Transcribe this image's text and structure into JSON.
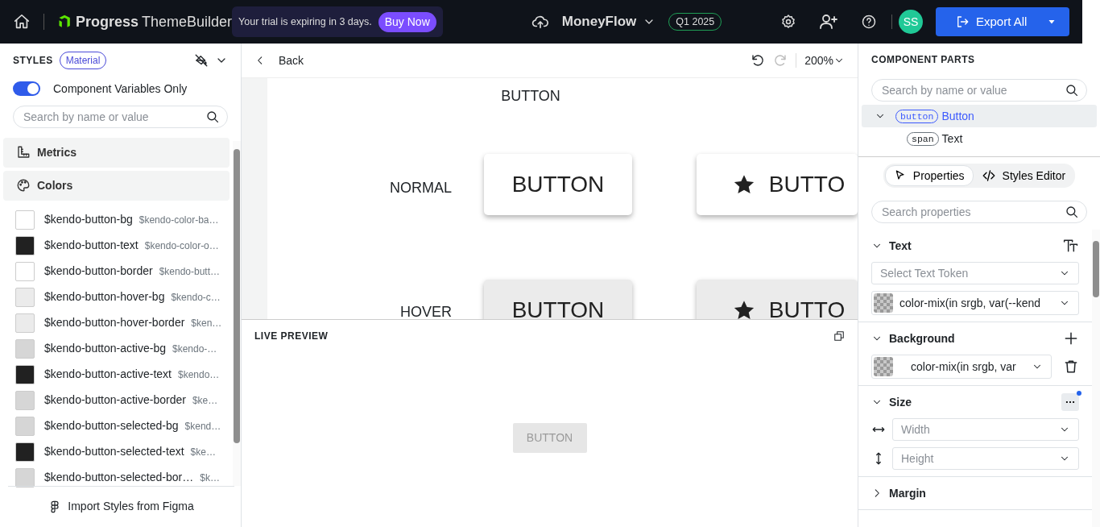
{
  "header": {
    "brand": "Progress",
    "product": "ThemeBuilder",
    "trial": {
      "message": "Your trial is expiring in 3 days.",
      "button": "Buy Now"
    },
    "project": {
      "name": "MoneyFlow",
      "badge": "Q1 2025"
    },
    "avatar": "SS",
    "export": "Export All"
  },
  "styles": {
    "title": "STYLES",
    "theme": "Material",
    "toggle": {
      "label": "Component Variables Only",
      "on": true
    },
    "search": {
      "placeholder": "Search by name or value"
    },
    "groups": [
      {
        "kind": "metrics",
        "label": "Metrics"
      },
      {
        "kind": "colors",
        "label": "Colors"
      }
    ],
    "variables": [
      {
        "name": "$kendo-button-bg",
        "value": "$kendo-color-ba…",
        "color": "#ffffff"
      },
      {
        "name": "$kendo-button-text",
        "value": "$kendo-color-o…",
        "color": "#212121"
      },
      {
        "name": "$kendo-button-border",
        "value": "$kendo-butt…",
        "color": "#ffffff"
      },
      {
        "name": "$kendo-button-hover-bg",
        "value": "$kendo-c…",
        "color": "#ebebeb"
      },
      {
        "name": "$kendo-button-hover-border",
        "value": "$ken…",
        "color": "#ebebeb"
      },
      {
        "name": "$kendo-button-active-bg",
        "value": "$kendo-…",
        "color": "#d6d6d6"
      },
      {
        "name": "$kendo-button-active-text",
        "value": "$kendo…",
        "color": "#212121"
      },
      {
        "name": "$kendo-button-active-border",
        "value": "$ke…",
        "color": "#d6d6d6"
      },
      {
        "name": "$kendo-button-selected-bg",
        "value": "$kend…",
        "color": "#d6d6d6"
      },
      {
        "name": "$kendo-button-selected-text",
        "value": "$ke…",
        "color": "#212121"
      },
      {
        "name": "$kendo-button-selected-bor…",
        "value": "$k…",
        "color": "#d6d6d6"
      }
    ],
    "import": "Import Styles from Figma"
  },
  "canvas": {
    "back": "Back",
    "zoom": "200%",
    "title": "BUTTON",
    "states": [
      {
        "label": "NORMAL",
        "kind": "normal",
        "buttons": [
          {
            "text": "BUTTON",
            "icon": false
          },
          {
            "text": "BUTTO",
            "icon": true
          }
        ]
      },
      {
        "label": "HOVER",
        "kind": "hover",
        "buttons": [
          {
            "text": "BUTTON",
            "icon": false
          },
          {
            "text": "BUTTO",
            "icon": true
          }
        ]
      }
    ],
    "preview": {
      "title": "LIVE PREVIEW",
      "button": "BUTTON"
    }
  },
  "parts": {
    "title": "COMPONENT PARTS",
    "search": {
      "placeholder": "Search by name or value"
    },
    "tree": [
      {
        "tag": "button",
        "label": "Button",
        "expanded": true,
        "selected": true,
        "children": [
          {
            "tag": "span",
            "label": "Text",
            "selected": false
          }
        ]
      }
    ],
    "tabs": [
      {
        "label": "Properties",
        "selected": true
      },
      {
        "label": "Styles Editor",
        "selected": false
      }
    ],
    "property_search": {
      "placeholder": "Search properties"
    },
    "sections": [
      {
        "title": "Text",
        "kind": "text",
        "expanded": true,
        "fields": [
          {
            "kind": "select",
            "placeholder": "Select Text Token"
          },
          {
            "kind": "color",
            "value": "color-mix(in srgb, var(--kend"
          }
        ]
      },
      {
        "title": "Background",
        "kind": "background",
        "expanded": true,
        "fields": [
          {
            "kind": "color-removable",
            "value": "color-mix(in srgb, var"
          }
        ]
      },
      {
        "title": "Size",
        "kind": "size",
        "expanded": true,
        "fields": [
          {
            "kind": "width",
            "placeholder": "Width"
          },
          {
            "kind": "height",
            "placeholder": "Height"
          }
        ]
      },
      {
        "title": "Margin",
        "kind": "margin",
        "expanded": false
      }
    ]
  }
}
